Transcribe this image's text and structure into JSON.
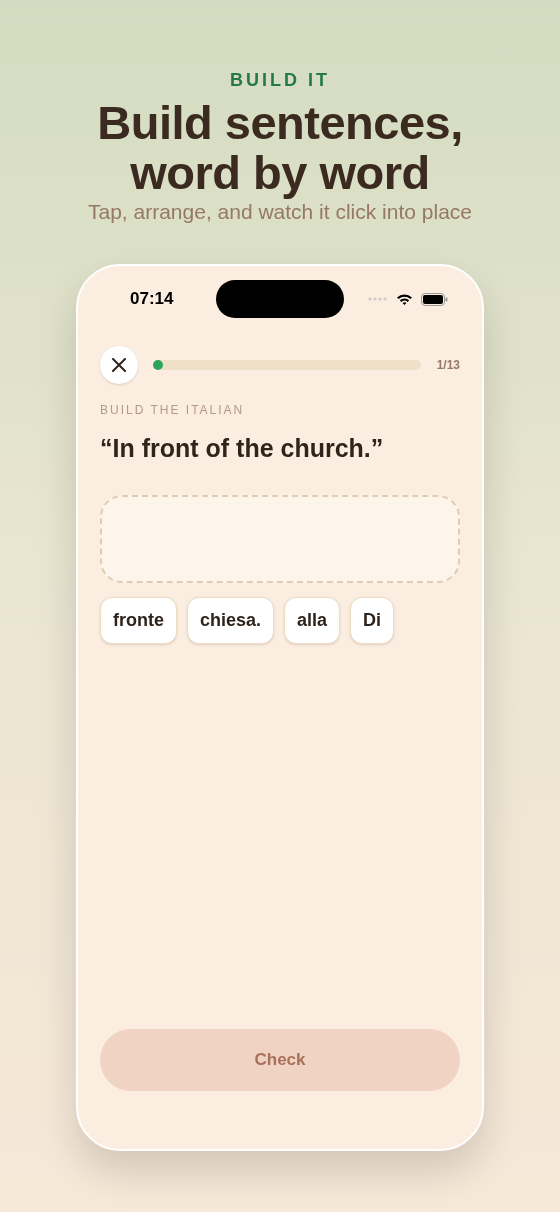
{
  "header": {
    "eyebrow": "BUILD IT",
    "title_lines": [
      "Build sentences,",
      "word by word"
    ],
    "subtitle": "Tap, arrange, and watch it click into place"
  },
  "status_bar": {
    "time": "07:14"
  },
  "progress": {
    "level": 0.02,
    "counter": "1/13"
  },
  "prompt": {
    "label": "BUILD THE ITALIAN",
    "sentence": "“In front of the church.”"
  },
  "word_bank": [
    {
      "word": "fronte"
    },
    {
      "word": "chiesa."
    },
    {
      "word": "alla"
    },
    {
      "word": "Di"
    }
  ],
  "check_button": {
    "label": "Check",
    "disabled": true
  }
}
